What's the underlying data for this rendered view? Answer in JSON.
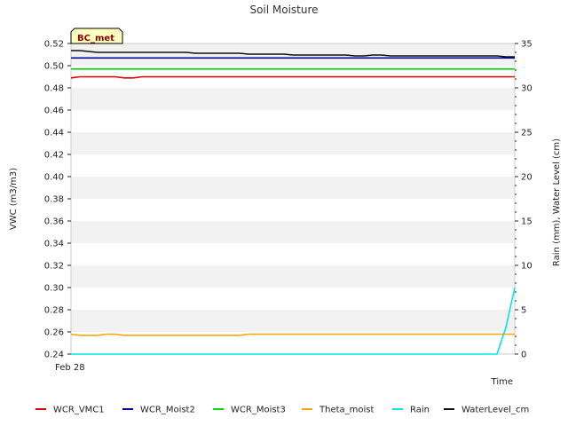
{
  "chart_data": {
    "type": "line",
    "title": "Soil Moisture",
    "xlabel": "Time",
    "ylabel": "VWC (m3/m3)",
    "y2label": "Rain (mm), Water Level (cm)",
    "station": "BC_met",
    "x_tick_labels": [
      "Feb 28"
    ],
    "x": [
      0,
      1,
      2,
      3,
      4,
      5,
      6,
      7,
      8,
      9,
      10,
      11,
      12,
      13,
      14,
      15,
      16,
      17,
      18,
      19,
      20,
      21,
      22,
      23,
      24,
      25,
      26,
      27,
      28,
      29,
      30,
      31,
      32,
      33,
      34,
      35,
      36,
      37,
      38,
      39,
      40,
      41,
      42,
      43,
      44,
      45,
      46,
      47,
      48,
      49,
      50
    ],
    "ylim": [
      0.24,
      0.52
    ],
    "y2lim": [
      0,
      35
    ],
    "yticks": [
      "0.24",
      "0.26",
      "0.28",
      "0.30",
      "0.32",
      "0.34",
      "0.36",
      "0.38",
      "0.40",
      "0.42",
      "0.44",
      "0.46",
      "0.48",
      "0.50",
      "0.52"
    ],
    "y2ticks": [
      "0",
      "5",
      "10",
      "15",
      "20",
      "25",
      "30",
      "35"
    ],
    "grid": "horizontal bands",
    "legend_position": "bottom",
    "series": [
      {
        "name": "WCR_VMC1",
        "axis": "left",
        "color": "#dd0000",
        "values": [
          0.489,
          0.49,
          0.49,
          0.49,
          0.49,
          0.49,
          0.489,
          0.489,
          0.49,
          0.49,
          0.49,
          0.49,
          0.49,
          0.49,
          0.49,
          0.49,
          0.49,
          0.49,
          0.49,
          0.49,
          0.49,
          0.49,
          0.49,
          0.49,
          0.49,
          0.49,
          0.49,
          0.49,
          0.49,
          0.49,
          0.49,
          0.49,
          0.49,
          0.49,
          0.49,
          0.49,
          0.49,
          0.49,
          0.49,
          0.49,
          0.49,
          0.49,
          0.49,
          0.49,
          0.49,
          0.49,
          0.49,
          0.49,
          0.49,
          0.49,
          0.49
        ]
      },
      {
        "name": "WCR_Moist2",
        "axis": "left",
        "color": "#000099",
        "values": [
          0.507,
          0.507,
          0.507,
          0.507,
          0.507,
          0.507,
          0.507,
          0.507,
          0.507,
          0.507,
          0.507,
          0.507,
          0.507,
          0.507,
          0.507,
          0.507,
          0.507,
          0.507,
          0.507,
          0.507,
          0.507,
          0.507,
          0.507,
          0.507,
          0.507,
          0.507,
          0.507,
          0.507,
          0.507,
          0.507,
          0.507,
          0.507,
          0.507,
          0.507,
          0.507,
          0.507,
          0.507,
          0.507,
          0.507,
          0.507,
          0.507,
          0.507,
          0.507,
          0.507,
          0.507,
          0.507,
          0.507,
          0.507,
          0.507,
          0.507,
          0.507
        ]
      },
      {
        "name": "WCR_Moist3",
        "axis": "left",
        "color": "#00dd00",
        "values": [
          0.497,
          0.497,
          0.497,
          0.497,
          0.497,
          0.497,
          0.497,
          0.497,
          0.497,
          0.497,
          0.497,
          0.497,
          0.497,
          0.497,
          0.497,
          0.497,
          0.497,
          0.497,
          0.497,
          0.497,
          0.497,
          0.497,
          0.497,
          0.497,
          0.497,
          0.497,
          0.497,
          0.497,
          0.497,
          0.497,
          0.497,
          0.497,
          0.497,
          0.497,
          0.497,
          0.497,
          0.497,
          0.497,
          0.497,
          0.497,
          0.497,
          0.497,
          0.497,
          0.497,
          0.497,
          0.497,
          0.497,
          0.497,
          0.497,
          0.497,
          0.497
        ]
      },
      {
        "name": "Theta_moist",
        "axis": "left",
        "color": "#ffa500",
        "values": [
          0.258,
          0.257,
          0.257,
          0.257,
          0.258,
          0.258,
          0.257,
          0.257,
          0.257,
          0.257,
          0.257,
          0.257,
          0.257,
          0.257,
          0.257,
          0.257,
          0.257,
          0.257,
          0.257,
          0.257,
          0.258,
          0.258,
          0.258,
          0.258,
          0.258,
          0.258,
          0.258,
          0.258,
          0.258,
          0.258,
          0.258,
          0.258,
          0.258,
          0.258,
          0.258,
          0.258,
          0.258,
          0.258,
          0.258,
          0.258,
          0.258,
          0.258,
          0.258,
          0.258,
          0.258,
          0.258,
          0.258,
          0.258,
          0.258,
          0.258,
          0.258
        ]
      },
      {
        "name": "Rain",
        "axis": "right",
        "color": "#00e5e5",
        "values": [
          0,
          0,
          0,
          0,
          0,
          0,
          0,
          0,
          0,
          0,
          0,
          0,
          0,
          0,
          0,
          0,
          0,
          0,
          0,
          0,
          0,
          0,
          0,
          0,
          0,
          0,
          0,
          0,
          0,
          0,
          0,
          0,
          0,
          0,
          0,
          0,
          0,
          0,
          0,
          0,
          0,
          0,
          0,
          0,
          0,
          0,
          0,
          0,
          0,
          3.0,
          7.5
        ]
      },
      {
        "name": "WaterLevel_cm",
        "axis": "right",
        "color": "#111111",
        "values": [
          34.2,
          34.2,
          34.1,
          34.0,
          34.0,
          34.0,
          34.0,
          34.0,
          34.0,
          34.0,
          34.0,
          34.0,
          34.0,
          34.0,
          33.9,
          33.9,
          33.9,
          33.9,
          33.9,
          33.9,
          33.8,
          33.8,
          33.8,
          33.8,
          33.8,
          33.7,
          33.7,
          33.7,
          33.7,
          33.7,
          33.7,
          33.7,
          33.6,
          33.6,
          33.7,
          33.7,
          33.6,
          33.6,
          33.6,
          33.6,
          33.6,
          33.6,
          33.6,
          33.6,
          33.6,
          33.6,
          33.6,
          33.6,
          33.6,
          33.5,
          33.5
        ]
      }
    ]
  }
}
